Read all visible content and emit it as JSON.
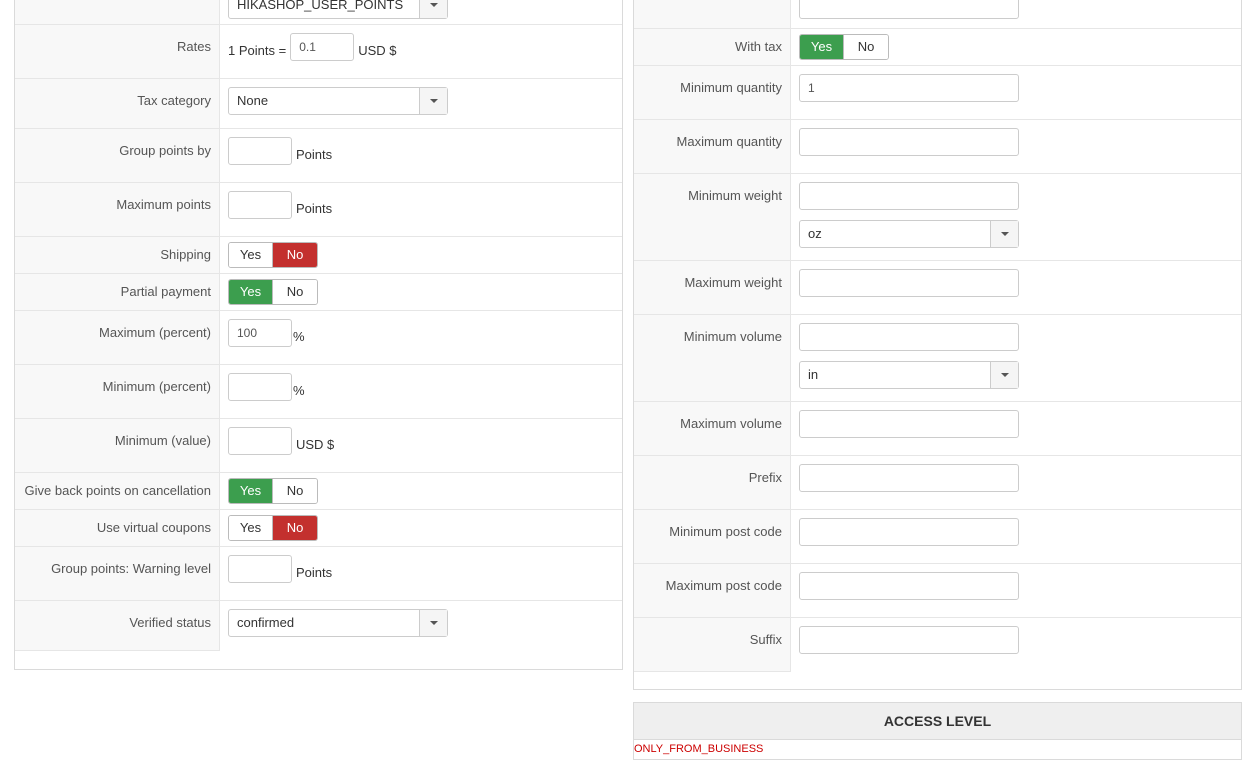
{
  "left": {
    "top_select": {
      "value": "HIKASHOP_USER_POINTS"
    },
    "rates": {
      "label": "Rates",
      "prefix": "1 Points =",
      "value": "0.1",
      "unit": "USD $"
    },
    "tax_category": {
      "label": "Tax category",
      "value": "None"
    },
    "group_points_by": {
      "label": "Group points by",
      "value": "",
      "unit": "Points"
    },
    "maximum_points": {
      "label": "Maximum points",
      "value": "",
      "unit": "Points"
    },
    "shipping": {
      "label": "Shipping",
      "yes": "Yes",
      "no": "No",
      "selected": "No"
    },
    "partial_payment": {
      "label": "Partial payment",
      "yes": "Yes",
      "no": "No",
      "selected": "Yes"
    },
    "maximum_percent": {
      "label": "Maximum (percent)",
      "value": "100",
      "unit": "%"
    },
    "minimum_percent": {
      "label": "Minimum (percent)",
      "value": "",
      "unit": "%"
    },
    "minimum_value": {
      "label": "Minimum (value)",
      "value": "",
      "unit": "USD $"
    },
    "give_back_points": {
      "label": "Give back points on cancellation",
      "yes": "Yes",
      "no": "No",
      "selected": "Yes"
    },
    "use_virtual_coupons": {
      "label": "Use virtual coupons",
      "yes": "Yes",
      "no": "No",
      "selected": "No"
    },
    "warning_level": {
      "label": "Group points: Warning level",
      "value": "",
      "unit": "Points"
    },
    "verified_status": {
      "label": "Verified status",
      "value": "confirmed"
    }
  },
  "right": {
    "top_field": {
      "value": ""
    },
    "with_tax": {
      "label": "With tax",
      "yes": "Yes",
      "no": "No",
      "selected": "Yes"
    },
    "minimum_quantity": {
      "label": "Minimum quantity",
      "value": "1"
    },
    "maximum_quantity": {
      "label": "Maximum quantity",
      "value": ""
    },
    "minimum_weight": {
      "label": "Minimum weight",
      "value": "",
      "unit": "oz"
    },
    "maximum_weight": {
      "label": "Maximum weight",
      "value": ""
    },
    "minimum_volume": {
      "label": "Minimum volume",
      "value": "",
      "unit": "in"
    },
    "maximum_volume": {
      "label": "Maximum volume",
      "value": ""
    },
    "prefix": {
      "label": "Prefix",
      "value": ""
    },
    "minimum_post_code": {
      "label": "Minimum post code",
      "value": ""
    },
    "maximum_post_code": {
      "label": "Maximum post code",
      "value": ""
    },
    "suffix": {
      "label": "Suffix",
      "value": ""
    }
  },
  "access_level": {
    "title": "ACCESS LEVEL",
    "value": "ONLY_FROM_BUSINESS"
  },
  "colors": {
    "yes_active": "#3c9e4e",
    "no_active": "#c3302e",
    "access_value": "#cc0000"
  }
}
